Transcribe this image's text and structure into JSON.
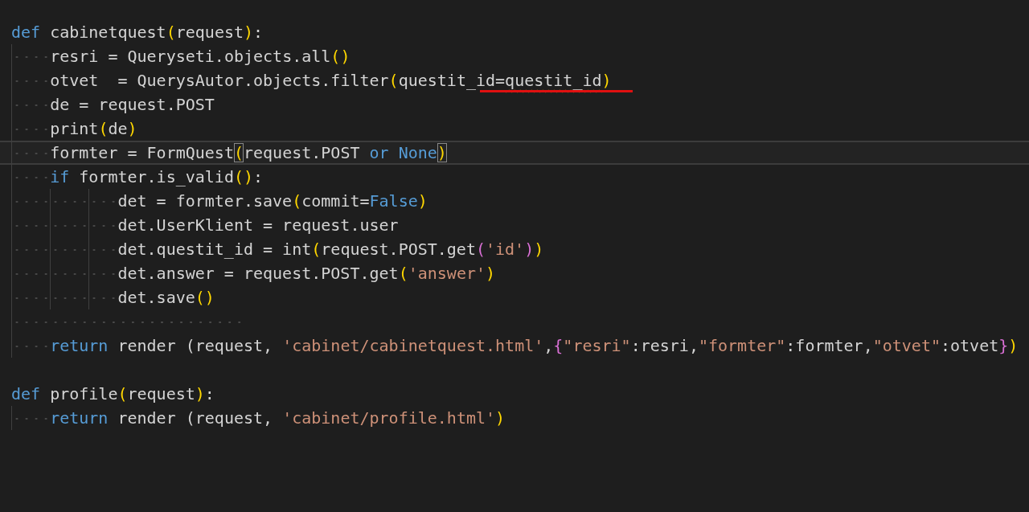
{
  "editor": {
    "lines": [
      {
        "kind": "code",
        "current": false,
        "tokens": [
          {
            "text": "def",
            "kind": "keyword"
          },
          {
            "text": " cabinetquest",
            "kind": "plain"
          },
          {
            "text": "(",
            "kind": "paren"
          },
          {
            "text": "request",
            "kind": "plain"
          },
          {
            "text": ")",
            "kind": "paren"
          },
          {
            "text": ":",
            "kind": "plain"
          }
        ],
        "children": [
          {
            "kind": "code",
            "current": false,
            "tokens": [
              {
                "text": "resri = Queryseti.objects.all",
                "kind": "plain"
              },
              {
                "text": "()",
                "kind": "paren"
              }
            ]
          },
          {
            "kind": "code",
            "current": false,
            "marked": true,
            "tokens": [
              {
                "text": "otvet  = QuerysAutor.objects.filter",
                "kind": "plain"
              },
              {
                "text": "(",
                "kind": "paren"
              },
              {
                "text": "questit_id=",
                "kind": "plain"
              },
              {
                "text": "questit_id",
                "kind": "warning"
              },
              {
                "text": ")",
                "kind": "paren"
              }
            ]
          },
          {
            "kind": "code",
            "current": false,
            "tokens": [
              {
                "text": "de = request.POST",
                "kind": "plain"
              }
            ]
          },
          {
            "kind": "code",
            "current": false,
            "tokens": [
              {
                "text": "print",
                "kind": "plain"
              },
              {
                "text": "(",
                "kind": "paren"
              },
              {
                "text": "de",
                "kind": "plain"
              },
              {
                "text": ")",
                "kind": "paren"
              }
            ]
          },
          {
            "kind": "code",
            "current": true,
            "tokens": [
              {
                "text": "formter = FormQuest",
                "kind": "plain"
              },
              {
                "text": "(",
                "kind": "match"
              },
              {
                "text": "request.POST ",
                "kind": "plain"
              },
              {
                "text": "or None",
                "kind": "keyword"
              },
              {
                "text": ")",
                "kind": "match"
              }
            ]
          },
          {
            "kind": "code",
            "current": false,
            "tokens": [
              {
                "text": "if",
                "kind": "keyword"
              },
              {
                "text": " formter.is_valid",
                "kind": "plain"
              },
              {
                "text": "()",
                "kind": "paren"
              },
              {
                "text": ":",
                "kind": "plain"
              }
            ],
            "children": [
              {
                "kind": "code",
                "current": false,
                "tokens": [
                  {
                    "text": "det = formter.save",
                    "kind": "plain"
                  },
                  {
                    "text": "(",
                    "kind": "paren"
                  },
                  {
                    "text": "commit=",
                    "kind": "plain"
                  },
                  {
                    "text": "False",
                    "kind": "keyword"
                  },
                  {
                    "text": ")",
                    "kind": "paren"
                  }
                ]
              },
              {
                "kind": "code",
                "current": false,
                "tokens": [
                  {
                    "text": "det.UserKlient = request.user",
                    "kind": "plain"
                  }
                ]
              },
              {
                "kind": "code",
                "current": false,
                "tokens": [
                  {
                    "text": "det.questit_id = int",
                    "kind": "plain"
                  },
                  {
                    "text": "(",
                    "kind": "paren"
                  },
                  {
                    "text": "request.POST.get",
                    "kind": "plain"
                  },
                  {
                    "text": "(",
                    "kind": "paren2"
                  },
                  {
                    "text": "'id'",
                    "kind": "string"
                  },
                  {
                    "text": ")",
                    "kind": "paren2"
                  },
                  {
                    "text": ")",
                    "kind": "paren"
                  }
                ]
              },
              {
                "kind": "code",
                "current": false,
                "tokens": [
                  {
                    "text": "det.answer = request.POST.get",
                    "kind": "plain"
                  },
                  {
                    "text": "(",
                    "kind": "paren"
                  },
                  {
                    "text": "'answer'",
                    "kind": "string"
                  },
                  {
                    "text": ")",
                    "kind": "paren"
                  }
                ]
              },
              {
                "kind": "code",
                "current": false,
                "tokens": [
                  {
                    "text": "det.save",
                    "kind": "plain"
                  },
                  {
                    "text": "()",
                    "kind": "paren"
                  }
                ]
              }
            ]
          },
          {
            "kind": "whitespace",
            "current": false
          },
          {
            "kind": "code",
            "current": false,
            "tokens": [
              {
                "text": "return",
                "kind": "keyword"
              },
              {
                "text": " render (request, ",
                "kind": "plain"
              },
              {
                "text": "'cabinet/cabinetquest.html'",
                "kind": "string"
              },
              {
                "text": ",",
                "kind": "plain"
              },
              {
                "text": "{",
                "kind": "paren2"
              },
              {
                "text": "\"resri\"",
                "kind": "string"
              },
              {
                "text": ":resri,",
                "kind": "plain"
              },
              {
                "text": "\"formter\"",
                "kind": "string"
              },
              {
                "text": ":formter,",
                "kind": "plain"
              },
              {
                "text": "\"otvet\"",
                "kind": "string"
              },
              {
                "text": ":otvet",
                "kind": "plain"
              },
              {
                "text": "}",
                "kind": "paren2"
              },
              {
                "text": ")",
                "kind": "paren"
              }
            ]
          }
        ]
      },
      {
        "kind": "blank",
        "current": false
      },
      {
        "kind": "code",
        "current": false,
        "tokens": [
          {
            "text": "def",
            "kind": "keyword"
          },
          {
            "text": " profile",
            "kind": "plain"
          },
          {
            "text": "(",
            "kind": "paren"
          },
          {
            "text": "request",
            "kind": "plain"
          },
          {
            "text": ")",
            "kind": "paren"
          },
          {
            "text": ":",
            "kind": "plain"
          }
        ],
        "children": [
          {
            "kind": "code",
            "current": false,
            "tokens": [
              {
                "text": "return",
                "kind": "keyword"
              },
              {
                "text": " render (request, ",
                "kind": "plain"
              },
              {
                "text": "'cabinet/profile.html'",
                "kind": "string"
              },
              {
                "text": ")",
                "kind": "paren"
              }
            ]
          }
        ]
      }
    ]
  }
}
